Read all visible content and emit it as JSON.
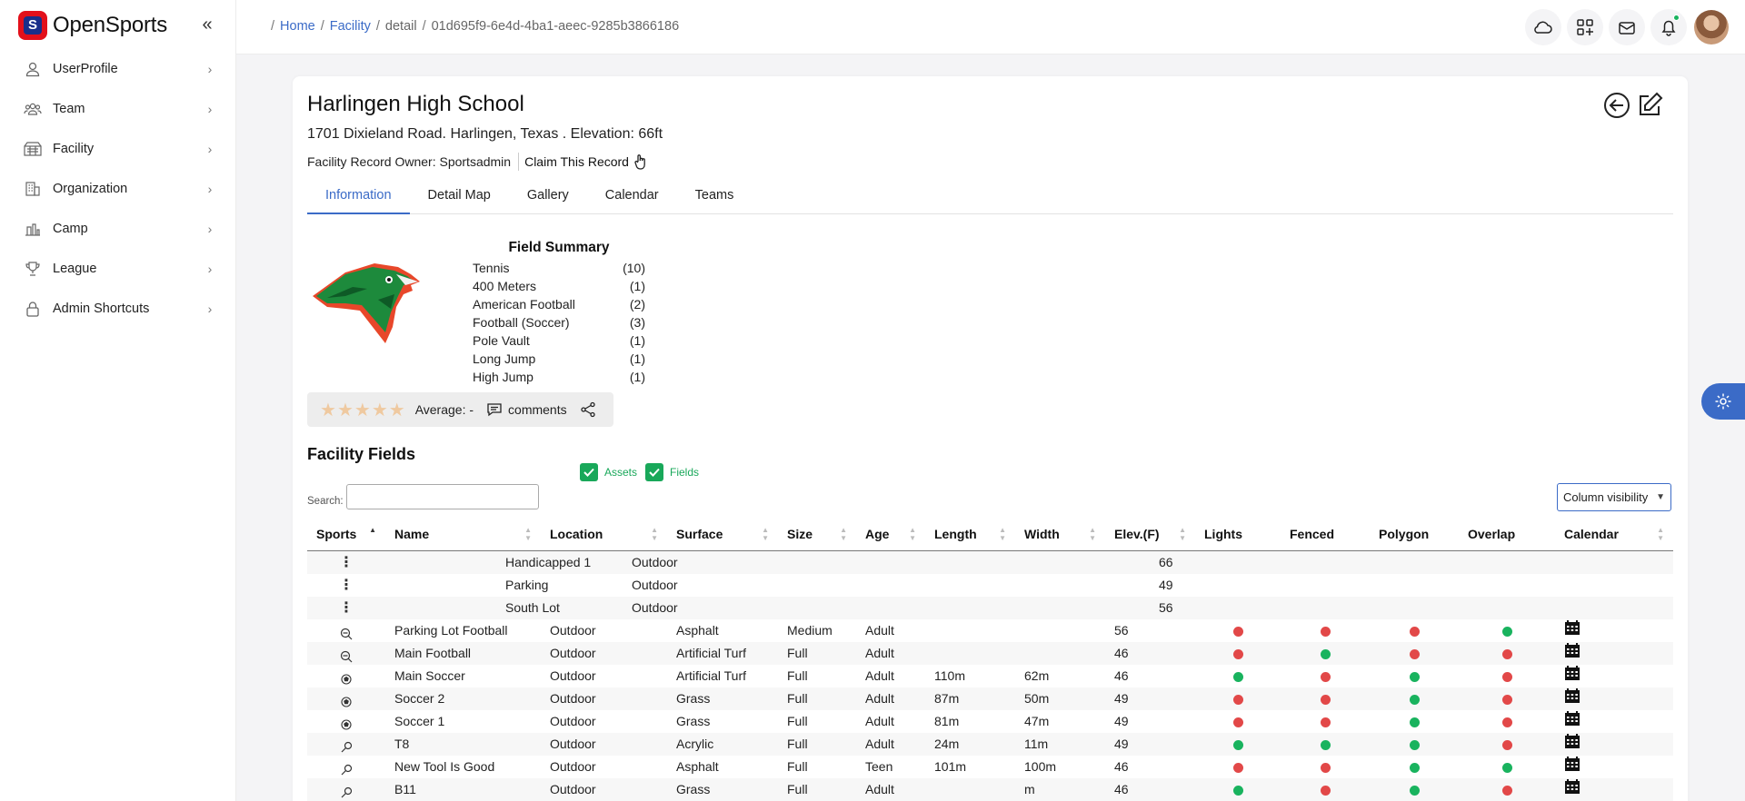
{
  "brand": {
    "name": "OpenSports",
    "logo_letter": "S"
  },
  "sidebar": {
    "collapse_icon": "chevrons-left-icon",
    "items": [
      {
        "label": "UserProfile",
        "icon": "user-icon"
      },
      {
        "label": "Team",
        "icon": "users-icon"
      },
      {
        "label": "Facility",
        "icon": "stadium-icon"
      },
      {
        "label": "Organization",
        "icon": "building-icon"
      },
      {
        "label": "Camp",
        "icon": "camp-icon"
      },
      {
        "label": "League",
        "icon": "trophy-icon"
      },
      {
        "label": "Admin Shortcuts",
        "icon": "lock-icon"
      }
    ]
  },
  "breadcrumb": {
    "home": "Home",
    "facility": "Facility",
    "detail": "detail",
    "id": "01d695f9-6e4d-4ba1-aeec-9285b3866186"
  },
  "facility": {
    "name": "Harlingen High School",
    "address": "1701 Dixieland Road. Harlingen, Texas . Elevation: 66ft",
    "owner": "Facility Record Owner: Sportsadmin",
    "claim": "Claim This Record"
  },
  "tabs": [
    "Information",
    "Detail Map",
    "Gallery",
    "Calendar",
    "Teams"
  ],
  "summary": {
    "title": "Field Summary",
    "rows": [
      {
        "name": "Tennis",
        "count": "(10)"
      },
      {
        "name": "400 Meters",
        "count": "(1)"
      },
      {
        "name": "American Football",
        "count": "(2)"
      },
      {
        "name": "Football (Soccer)",
        "count": "(3)"
      },
      {
        "name": "Pole Vault",
        "count": "(1)"
      },
      {
        "name": "Long Jump",
        "count": "(1)"
      },
      {
        "name": "High Jump",
        "count": "(1)"
      }
    ]
  },
  "rating": {
    "stars": 5,
    "filled": 0,
    "average": "Average: -",
    "comments": "comments"
  },
  "fields_section": {
    "title": "Facility Fields",
    "toggle_assets": "Assets",
    "toggle_fields": "Fields",
    "search_label": "Search:",
    "search_value": "",
    "column_visibility": "Column visibility"
  },
  "table": {
    "headers": [
      "Sports",
      "Name",
      "Location",
      "Surface",
      "Size",
      "Age",
      "Length",
      "Width",
      "Elev.(F)",
      "Lights",
      "Fenced",
      "Polygon",
      "Overlap",
      "Calendar"
    ],
    "asset_rows": [
      {
        "name": "Handicapped 1",
        "location": "Outdoor",
        "elev": "66"
      },
      {
        "name": "Parking",
        "location": "Outdoor",
        "elev": "49"
      },
      {
        "name": "South Lot",
        "location": "Outdoor",
        "elev": "56"
      }
    ],
    "field_rows": [
      {
        "sport": "football-icon",
        "name": "Parking Lot Football",
        "location": "Outdoor",
        "surface": "Asphalt",
        "size": "Medium",
        "age": "Adult",
        "length": "",
        "width": "",
        "elev": "56",
        "lights": "red",
        "fenced": "red",
        "polygon": "red",
        "overlap": "green"
      },
      {
        "sport": "football-icon",
        "name": "Main Football",
        "location": "Outdoor",
        "surface": "Artificial Turf",
        "size": "Full",
        "age": "Adult",
        "length": "",
        "width": "",
        "elev": "46",
        "lights": "red",
        "fenced": "green",
        "polygon": "red",
        "overlap": "red"
      },
      {
        "sport": "soccer-icon",
        "name": "Main Soccer",
        "location": "Outdoor",
        "surface": "Artificial Turf",
        "size": "Full",
        "age": "Adult",
        "length": "110m",
        "width": "62m",
        "elev": "46",
        "lights": "green",
        "fenced": "red",
        "polygon": "green",
        "overlap": "red"
      },
      {
        "sport": "soccer-icon",
        "name": "Soccer 2",
        "location": "Outdoor",
        "surface": "Grass",
        "size": "Full",
        "age": "Adult",
        "length": "87m",
        "width": "50m",
        "elev": "49",
        "lights": "red",
        "fenced": "red",
        "polygon": "green",
        "overlap": "red"
      },
      {
        "sport": "soccer-icon",
        "name": "Soccer 1",
        "location": "Outdoor",
        "surface": "Grass",
        "size": "Full",
        "age": "Adult",
        "length": "81m",
        "width": "47m",
        "elev": "49",
        "lights": "red",
        "fenced": "red",
        "polygon": "green",
        "overlap": "red"
      },
      {
        "sport": "tennis-icon",
        "name": "T8",
        "location": "Outdoor",
        "surface": "Acrylic",
        "size": "Full",
        "age": "Adult",
        "length": "24m",
        "width": "11m",
        "elev": "49",
        "lights": "green",
        "fenced": "green",
        "polygon": "green",
        "overlap": "red"
      },
      {
        "sport": "tennis-icon",
        "name": "New Tool Is Good",
        "location": "Outdoor",
        "surface": "Asphalt",
        "size": "Full",
        "age": "Teen",
        "length": "101m",
        "width": "100m",
        "elev": "46",
        "lights": "red",
        "fenced": "red",
        "polygon": "green",
        "overlap": "green"
      },
      {
        "sport": "tennis-icon",
        "name": "B11",
        "location": "Outdoor",
        "surface": "Grass",
        "size": "Full",
        "age": "Adult",
        "length": "",
        "width": "m",
        "elev": "46",
        "lights": "green",
        "fenced": "red",
        "polygon": "green",
        "overlap": "red"
      }
    ]
  },
  "colors": {
    "accent": "#3b6bc7",
    "brand_red": "#e3101b",
    "green": "#19b35e",
    "red": "#e24848"
  }
}
